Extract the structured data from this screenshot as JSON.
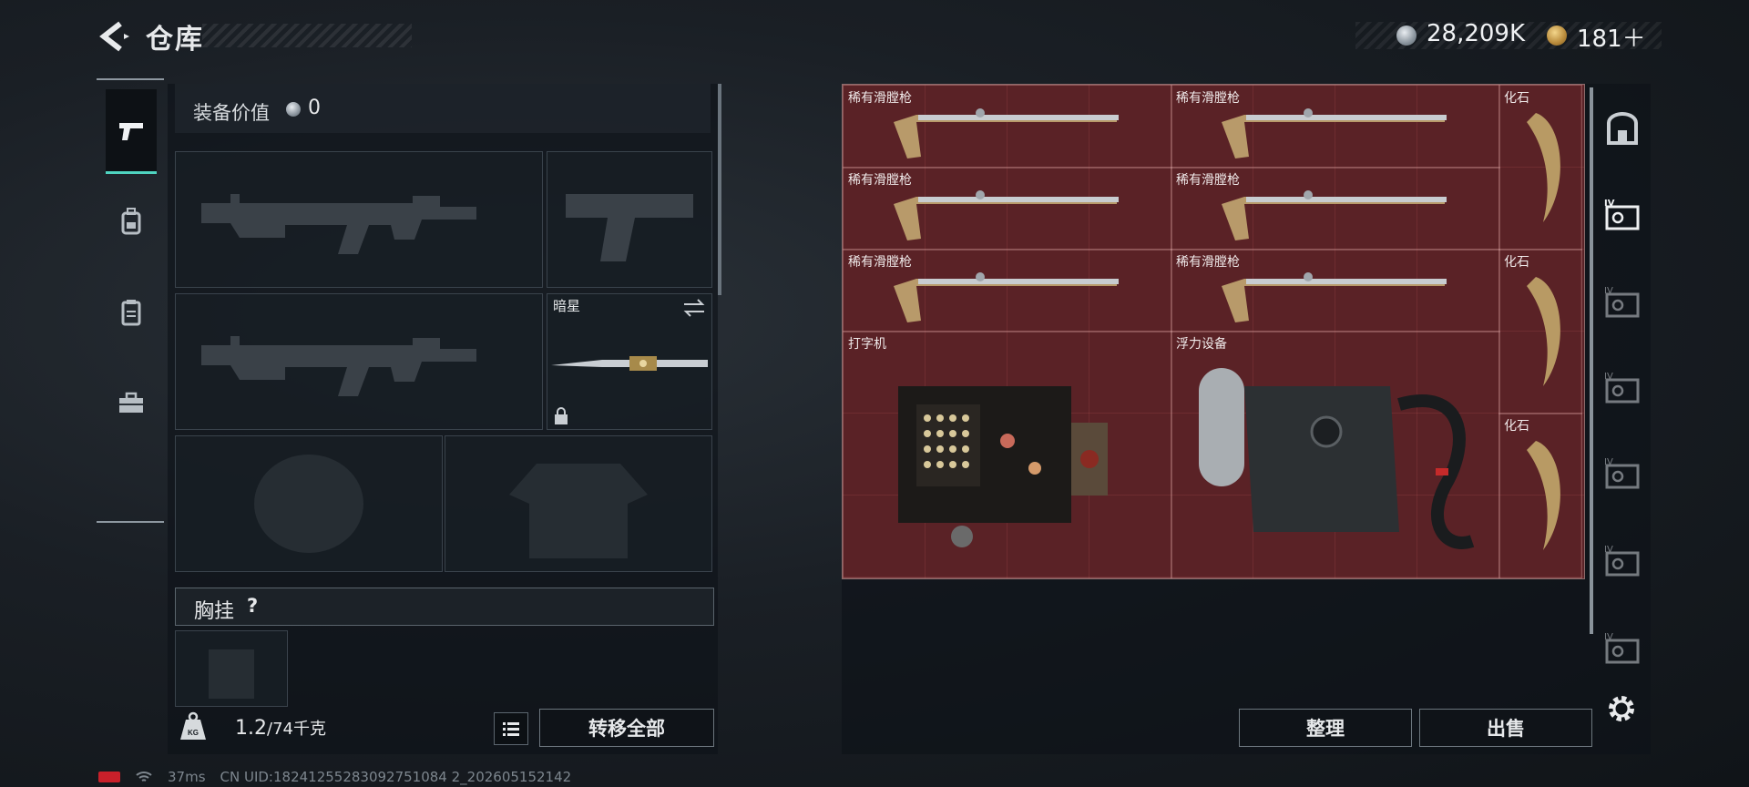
{
  "header": {
    "title": "仓库",
    "currency1": "28,209K",
    "currency2": "181＋"
  },
  "equipment": {
    "value_label": "装备价值",
    "value": "0",
    "melee_name": "暗星",
    "chest_rig_label": "胸挂",
    "chest_rig_help": "?",
    "weight_current": "1.2",
    "weight_max": "/74千克",
    "transfer_all_label": "转移全部"
  },
  "storage": {
    "items": [
      {
        "name": "稀有滑膛枪"
      },
      {
        "name": "稀有滑膛枪"
      },
      {
        "name": "化石"
      },
      {
        "name": "稀有滑膛枪"
      },
      {
        "name": "稀有滑膛枪"
      },
      {
        "name": "稀有滑膛枪"
      },
      {
        "name": "稀有滑膛枪"
      },
      {
        "name": "化石"
      },
      {
        "name": "打字机"
      },
      {
        "name": "浮力设备"
      },
      {
        "name": "化石"
      }
    ],
    "sort_label": "整理",
    "sell_label": "出售"
  },
  "status": {
    "ping": "37ms",
    "uid": "CN UID:18241255283092751084 2_202605152142"
  },
  "colors": {
    "accent": "#4fd4c0",
    "grid_bg": "#5a2226"
  }
}
